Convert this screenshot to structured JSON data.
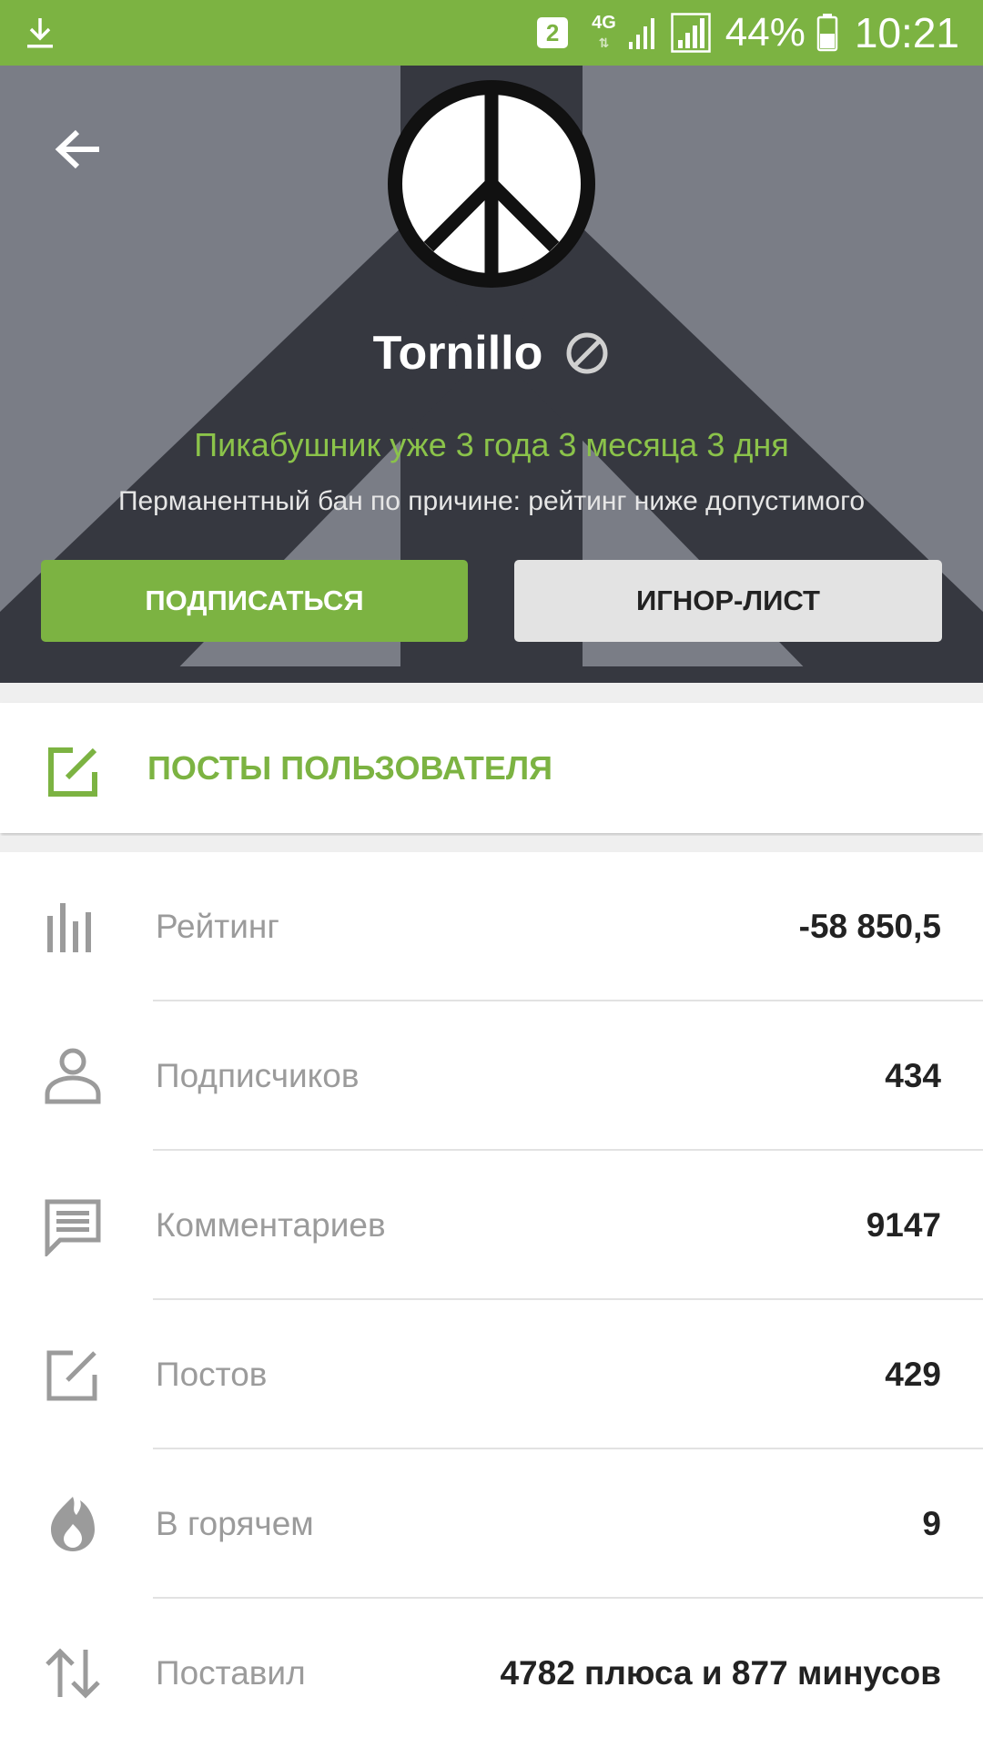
{
  "status_bar": {
    "sim_slot": "2",
    "network": "4G",
    "battery_percent": "44%",
    "time": "10:21"
  },
  "profile": {
    "username": "Tornillo",
    "tenure": "Пикабушник уже 3 года 3 месяца 3 дня",
    "ban_reason": "Перманентный бан по причине: рейтинг ниже допустимого",
    "subscribe_label": "ПОДПИСАТЬСЯ",
    "ignore_label": "ИГНОР-ЛИСТ"
  },
  "posts_section": {
    "label": "ПОСТЫ ПОЛЬЗОВАТЕЛЯ"
  },
  "stats": [
    {
      "icon": "bar-chart-icon",
      "label": "Рейтинг",
      "value": "-58 850,5"
    },
    {
      "icon": "person-icon",
      "label": "Подписчиков",
      "value": "434"
    },
    {
      "icon": "comment-icon",
      "label": "Комментариев",
      "value": "9147"
    },
    {
      "icon": "edit-icon",
      "label": "Постов",
      "value": "429"
    },
    {
      "icon": "flame-icon",
      "label": "В горячем",
      "value": "9"
    },
    {
      "icon": "swap-vertical-icon",
      "label": "Поставил",
      "value": "4782 плюса и 877 минусов"
    }
  ],
  "colors": {
    "accent": "#7cb342",
    "header_bg": "#7a7d86",
    "header_dark": "#363840"
  }
}
